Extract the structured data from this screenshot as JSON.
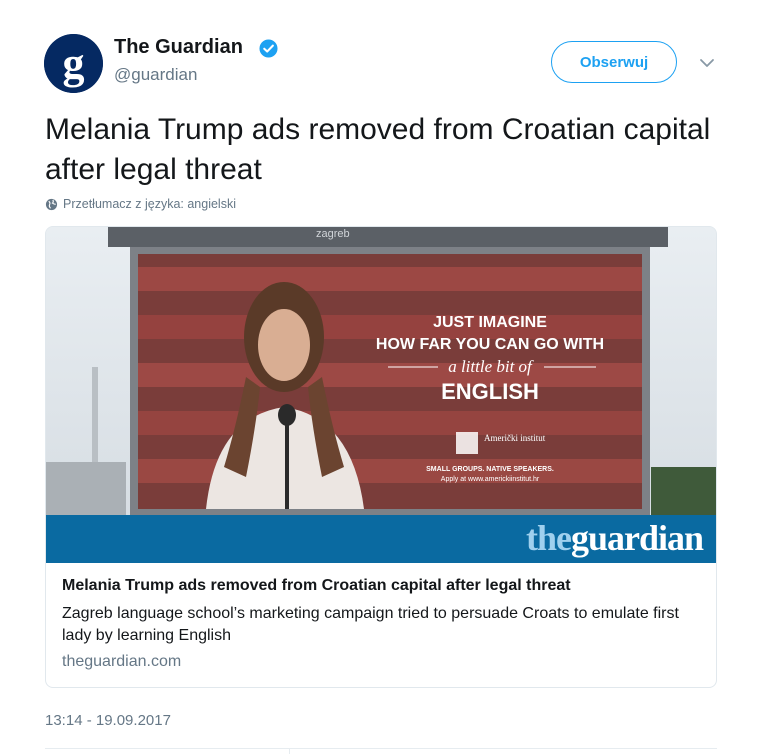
{
  "tweet": {
    "author_name": "The Guardian",
    "author_handle": "@guardian",
    "verified": true,
    "follow_label": "Obserwuj",
    "text": "Melania Trump ads removed from Croatian capital after legal threat",
    "translate_label": "Przetłumacz z języka: angielski",
    "timestamp": "13:14 - 19.09.2017"
  },
  "card": {
    "image": {
      "billboard_top": "zagreb",
      "billboard_line1": "JUST IMAGINE",
      "billboard_line2": "HOW FAR YOU CAN GO WITH",
      "billboard_line3": "a little bit of",
      "billboard_line4": "ENGLISH",
      "billboard_brand": "Američki institut",
      "billboard_small1": "SMALL GROUPS. NATIVE SPEAKERS.",
      "billboard_small2": "Apply at www.americkiinstitut.hr",
      "banner_the": "the",
      "banner_guardian": "guardian"
    },
    "title": "Melania Trump ads removed from Croatian capital after legal threat",
    "description": "Zagreb language school’s marketing campaign tried to persuade Croats to emulate first lady by learning English",
    "domain": "theguardian.com"
  },
  "colors": {
    "accent": "#1da1f2",
    "guardian_blue": "#052962",
    "banner_blue": "#0a6aa1",
    "muted": "#657786"
  },
  "icons": [
    "guardian-avatar-icon",
    "verified-badge-icon",
    "chevron-down-icon",
    "globe-icon"
  ]
}
